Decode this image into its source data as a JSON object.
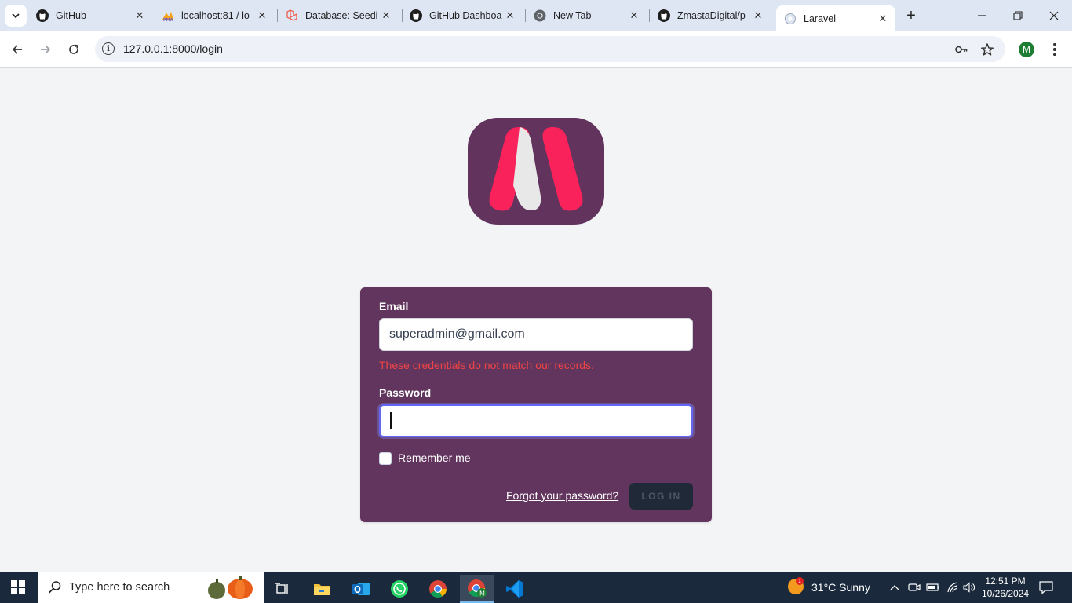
{
  "browser": {
    "tabs": [
      {
        "title": "GitHub",
        "icon": "github-icon"
      },
      {
        "title": "localhost:81 / lo",
        "icon": "phpmyadmin-icon"
      },
      {
        "title": "Database: Seedin",
        "icon": "laravel-icon"
      },
      {
        "title": "GitHub Dashboa",
        "icon": "github-icon"
      },
      {
        "title": "New Tab",
        "icon": "chrome-icon"
      },
      {
        "title": "ZmastaDigital/p",
        "icon": "github-icon"
      },
      {
        "title": "Laravel",
        "icon": "page-icon"
      }
    ],
    "active_tab": 6,
    "url": "127.0.0.1:8000/login",
    "profile_initial": "M"
  },
  "login_form": {
    "email_label": "Email",
    "email_value": "superadmin@gmail.com",
    "error_message": "These credentials do not match our records.",
    "password_label": "Password",
    "password_value": "",
    "remember_label": "Remember me",
    "remember_checked": false,
    "forgot_link": "Forgot your password?",
    "login_button": "LOG IN"
  },
  "taskbar": {
    "search_placeholder": "Type here to search",
    "weather": "31°C  Sunny",
    "weather_badge": "1",
    "time": "12:51 PM",
    "date": "10/26/2024"
  },
  "colors": {
    "brand_purple": "#62355e",
    "brand_pink": "#f9225b",
    "error_red": "#ef4444",
    "focus_ring": "#6366f1"
  }
}
